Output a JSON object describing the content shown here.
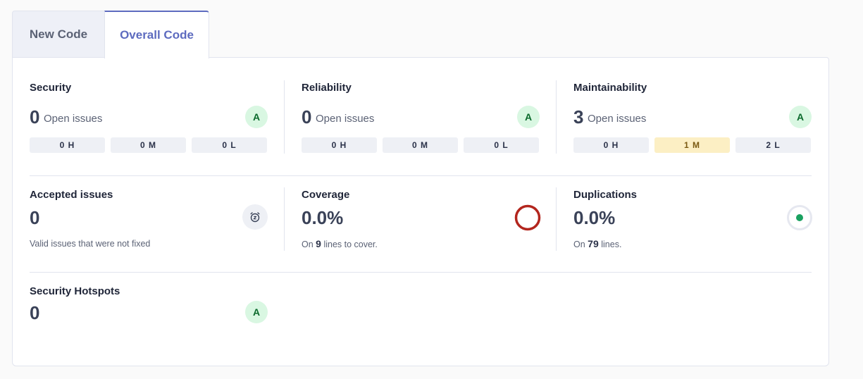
{
  "tabs": [
    {
      "label": "New Code"
    },
    {
      "label": "Overall Code"
    }
  ],
  "security": {
    "title": "Security",
    "count": "0",
    "open_label": "Open issues",
    "grade": "A",
    "severities": [
      "0 H",
      "0 M",
      "0 L"
    ]
  },
  "reliability": {
    "title": "Reliability",
    "count": "0",
    "open_label": "Open issues",
    "grade": "A",
    "severities": [
      "0 H",
      "0 M",
      "0 L"
    ]
  },
  "maintainability": {
    "title": "Maintainability",
    "count": "3",
    "open_label": "Open issues",
    "grade": "A",
    "severities": [
      "0 H",
      "1 M",
      "2 L"
    ]
  },
  "accepted": {
    "title": "Accepted issues",
    "count": "0",
    "subtitle": "Valid issues that were not fixed"
  },
  "coverage": {
    "title": "Coverage",
    "value": "0.0%",
    "sub_prefix": "On",
    "lines": "9",
    "sub_suffix": "lines to cover.",
    "ring_color": "#b3261e"
  },
  "duplications": {
    "title": "Duplications",
    "value": "0.0%",
    "sub_prefix": "On",
    "lines": "79",
    "sub_suffix": "lines.",
    "dot_color": "#1aa160"
  },
  "hotspots": {
    "title": "Security Hotspots",
    "count": "0",
    "grade": "A"
  },
  "colors": {
    "accent": "#5d6bbf",
    "grade_bg": "#d9f7e2",
    "grade_text": "#0b6a2c",
    "medium_bg": "#fcefc4"
  }
}
